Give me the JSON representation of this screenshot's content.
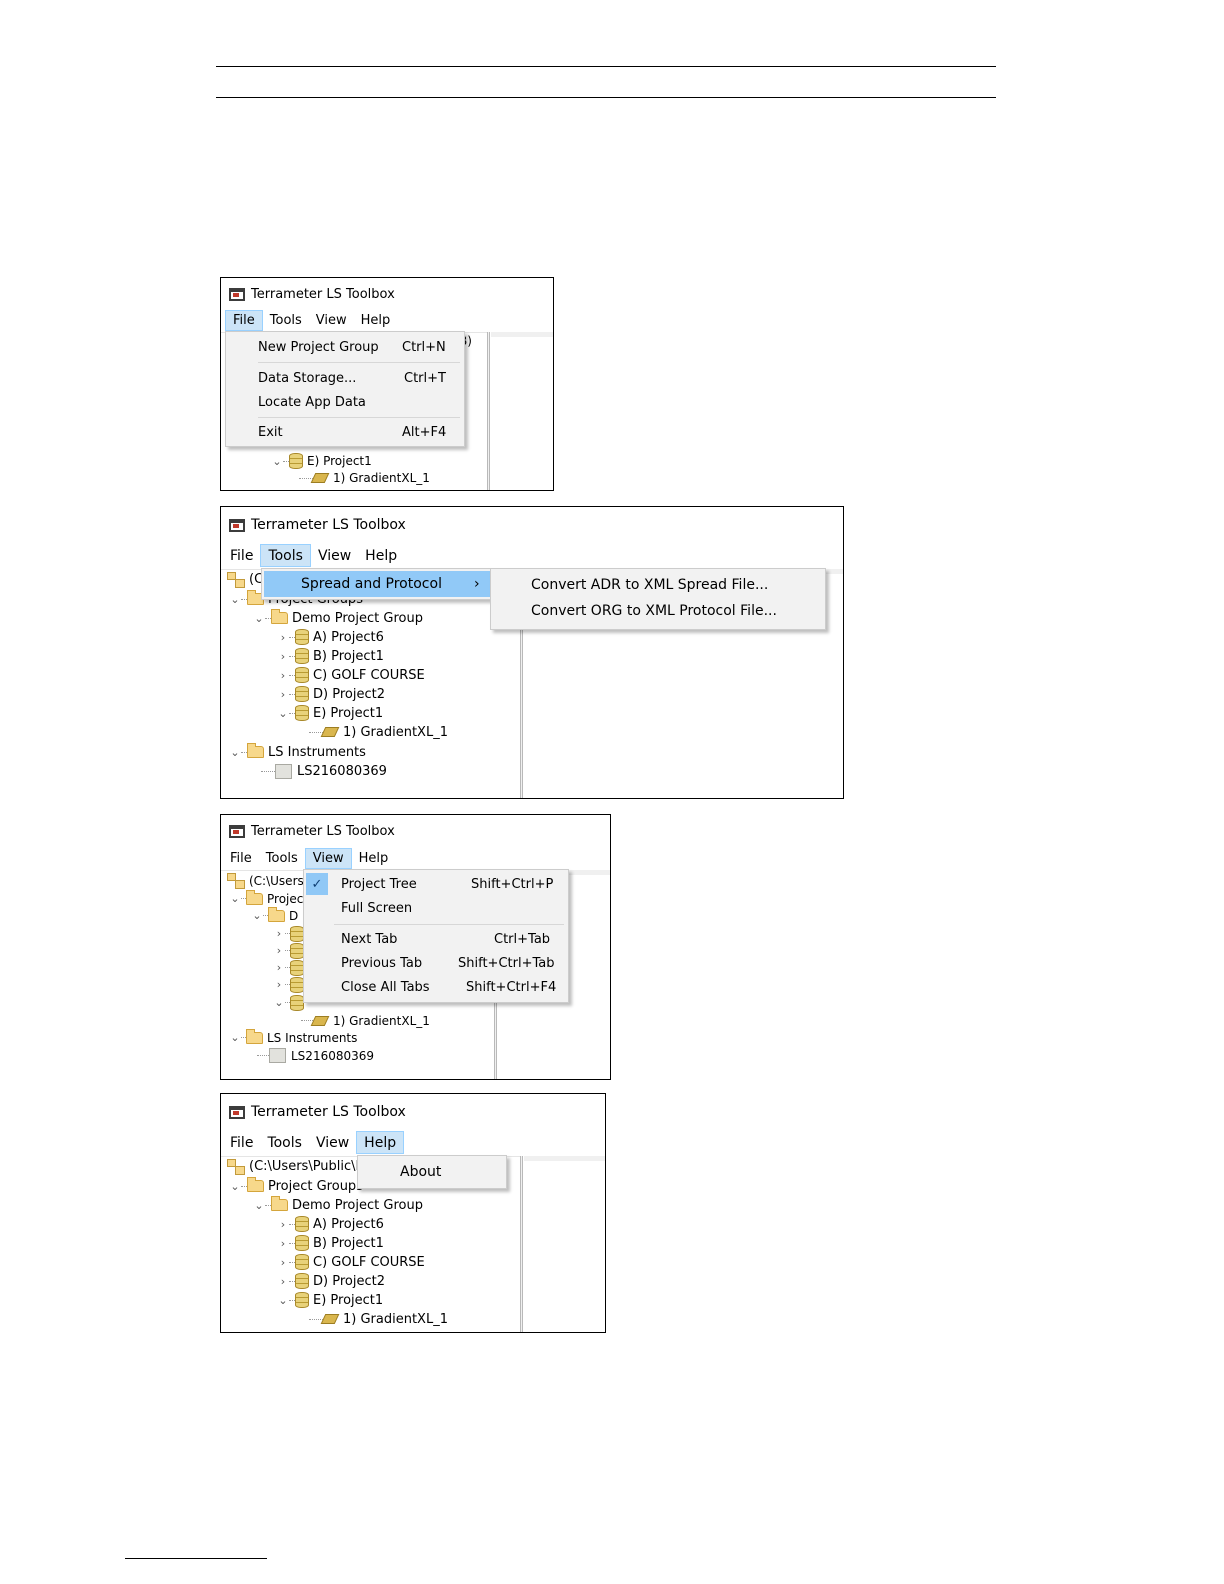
{
  "app_title": "Terrameter LS Toolbox",
  "menubar": {
    "file": "File",
    "tools": "Tools",
    "view": "View",
    "help": "Help"
  },
  "file_menu": {
    "items": [
      {
        "label": "New Project Group",
        "shortcut": "Ctrl+N"
      },
      {
        "label": "Data Storage...",
        "shortcut": "Ctrl+T"
      },
      {
        "label": "Locate App Data",
        "shortcut": ""
      },
      {
        "label": "Exit",
        "shortcut": "Alt+F4"
      }
    ],
    "partial_behind": "B)"
  },
  "tools_menu": {
    "item": "Spread and Protocol",
    "submenu": [
      "Convert ADR to XML Spread File...",
      "Convert ORG to XML Protocol File..."
    ]
  },
  "view_menu": {
    "items": [
      {
        "label": "Project Tree",
        "shortcut": "Shift+Ctrl+P",
        "checked": true
      },
      {
        "label": "Full Screen",
        "shortcut": ""
      },
      {
        "label": "Next Tab",
        "shortcut": "Ctrl+Tab"
      },
      {
        "label": "Previous Tab",
        "shortcut": "Shift+Ctrl+Tab"
      },
      {
        "label": "Close All Tabs",
        "shortcut": "Shift+Ctrl+F4"
      }
    ]
  },
  "help_menu": {
    "items": [
      "About"
    ]
  },
  "tree": {
    "root_path": "(C:\\Users\\Public\\D",
    "root_path_short": "(C:\\Users\\",
    "root_partial": "(C",
    "project_groups": "Project Groups",
    "project_groups_partial": "Projec",
    "demo_group": "Demo Project Group",
    "demo_group_partial": "D",
    "projects": [
      "A) Project6",
      "B) Project1",
      "C) GOLF COURSE",
      "D) Project2",
      "E) Project1"
    ],
    "project2_partial": "D) Project2",
    "gradient": "1) GradientXL_1",
    "ls_instruments": "LS Instruments",
    "instrument": "LS216080369"
  }
}
